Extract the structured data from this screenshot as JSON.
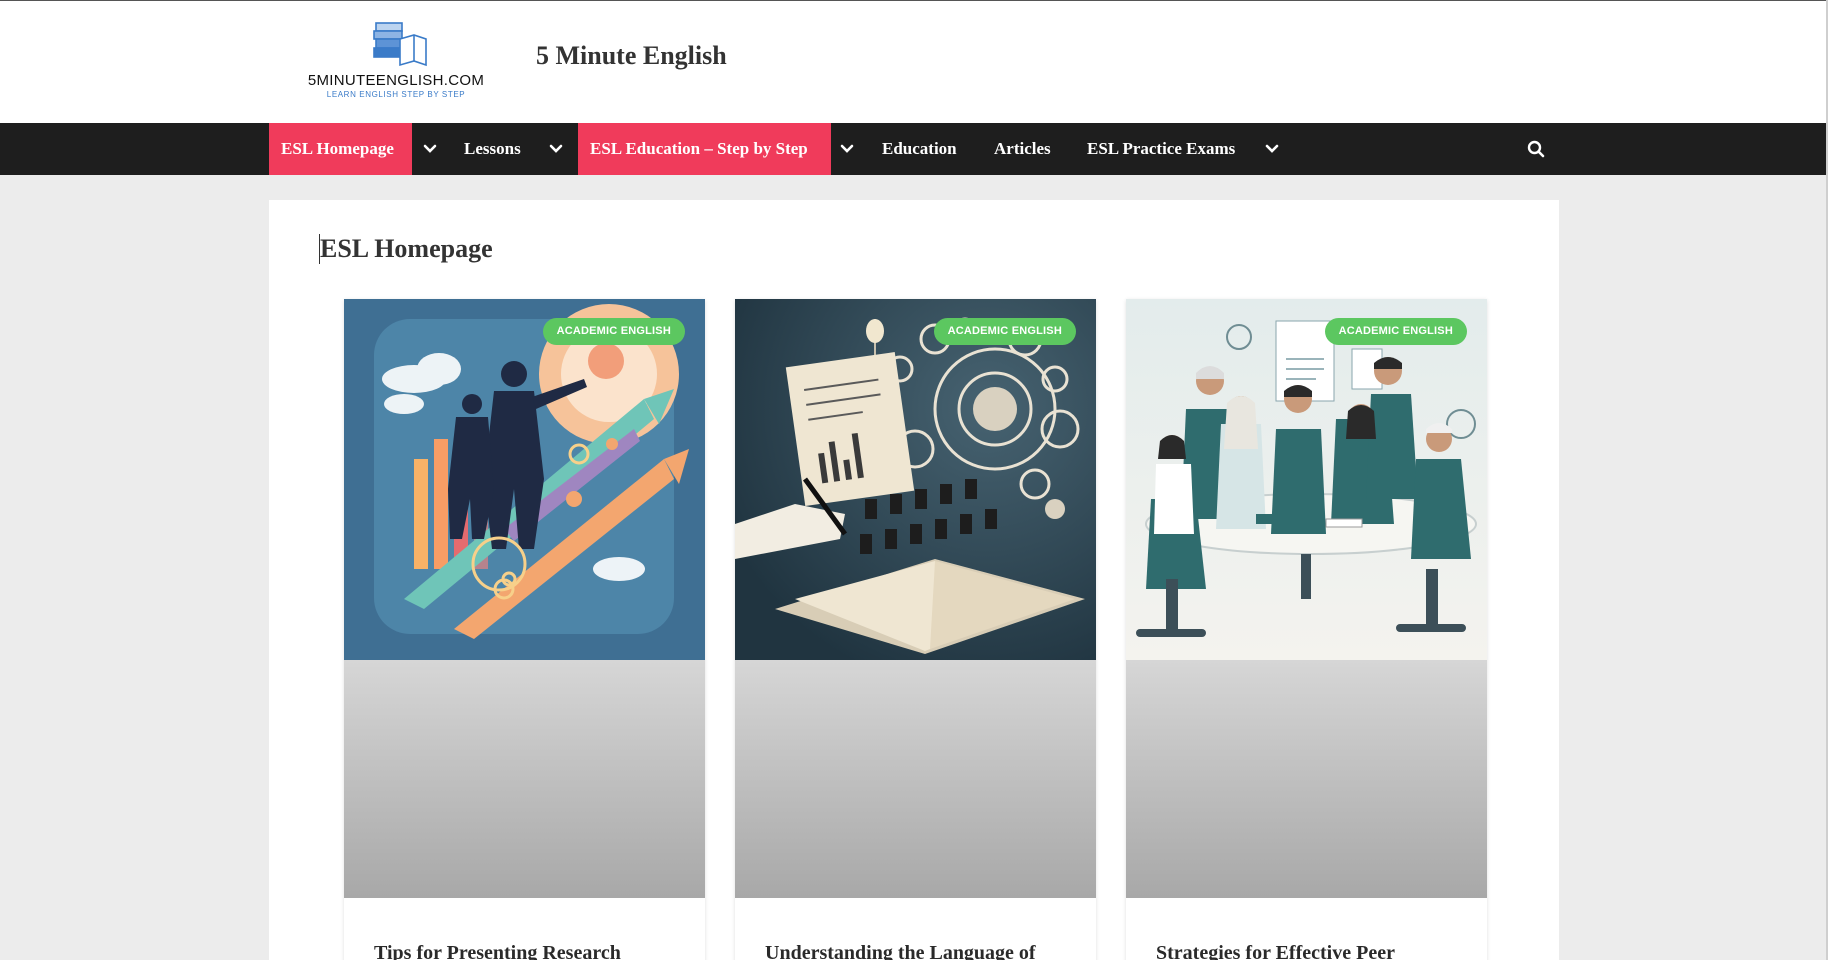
{
  "header": {
    "logo_text": "5MINUTEENGLISH.COM",
    "logo_tagline": "LEARN ENGLISH STEP BY STEP",
    "site_title": "5 Minute English"
  },
  "nav": {
    "items": [
      {
        "label": "ESL Homepage",
        "active": true,
        "has_dropdown": true
      },
      {
        "label": "Lessons",
        "active": false,
        "has_dropdown": true
      },
      {
        "label": "ESL Education – Step by Step",
        "active": true,
        "has_dropdown": true
      },
      {
        "label": "Education",
        "active": false,
        "has_dropdown": false
      },
      {
        "label": "Articles",
        "active": false,
        "has_dropdown": false
      },
      {
        "label": "ESL Practice Exams",
        "active": false,
        "has_dropdown": true
      }
    ],
    "search_icon": "search-icon",
    "dropdown_icon": "chevron-down-icon"
  },
  "main": {
    "page_title": "ESL Homepage",
    "posts": [
      {
        "category": "ACADEMIC ENGLISH",
        "title": "Tips for Presenting Research"
      },
      {
        "category": "ACADEMIC ENGLISH",
        "title": "Understanding the Language of"
      },
      {
        "category": "ACADEMIC ENGLISH",
        "title": "Strategies for Effective Peer"
      }
    ]
  },
  "colors": {
    "accent": "#f03b5b",
    "nav_bg": "#1e1e1e",
    "badge": "#5cc760",
    "page_bg": "#ececec"
  }
}
